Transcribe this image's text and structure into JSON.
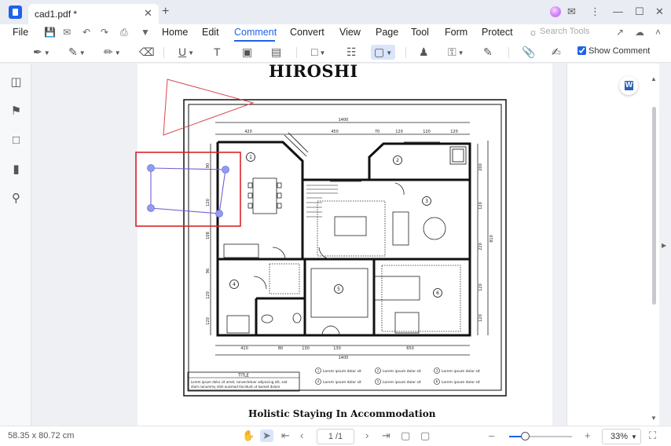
{
  "titlebar": {
    "tab_title": "cad1.pdf *",
    "tab_close": "✕",
    "new_tab": "+",
    "window_controls": {
      "feedback": "⋮",
      "minimize": "—",
      "maximize": "☐",
      "close": "✕"
    }
  },
  "menu": {
    "file": "File",
    "items": [
      "Home",
      "Edit",
      "Comment",
      "Convert",
      "View",
      "Page",
      "Tool",
      "Form",
      "Protect"
    ],
    "active": "Comment",
    "search_placeholder": "Search Tools"
  },
  "toolbar": {
    "show_comment_label": "Show Comment",
    "show_comment_checked": true
  },
  "document": {
    "title": "HIROSHI",
    "subtitle": "Holistic Staying In Accommodation",
    "dims": {
      "top_total": "1400",
      "top_segments": [
        "420",
        "450",
        "70",
        "120",
        "120",
        "120"
      ],
      "bottom_segments": [
        "410",
        "80",
        "130",
        "130",
        "650"
      ],
      "bottom_total": "1400",
      "left_segments": [
        "90",
        "120",
        "108",
        "96",
        "120",
        "120"
      ],
      "right_segments": [
        "200",
        "120",
        "220",
        "120",
        "120"
      ],
      "right_total": "810"
    },
    "room_numbers": [
      "1",
      "2",
      "3",
      "4",
      "5",
      "6"
    ],
    "legend_title": "TITLE",
    "legend_text_1": "Lorem ipsum dolor sit amet, consectetuer adipiscing elit, sed",
    "legend_text_2": "diam nonummy nibh euismod tincidunt ut laoreet dolore",
    "legend_items": [
      "Lorem ipsum dolor sit",
      "Lorem ipsum dolor sit",
      "Lorem ipsum dolor sit",
      "Lorem ipsum dolor sit",
      "Lorem ipsum dolor sit",
      "Lorem ipsum dolor sit"
    ]
  },
  "statusbar": {
    "dimensions": "58.35 x 80.72 cm",
    "page_indicator": "1 /1",
    "zoom": "33%",
    "zoom_fraction": 0.25
  },
  "colors": {
    "accent": "#1e63e9",
    "selection_red": "#d9252b",
    "annotation_purple": "#7b5bd6",
    "triangle_red": "#d9484e"
  }
}
